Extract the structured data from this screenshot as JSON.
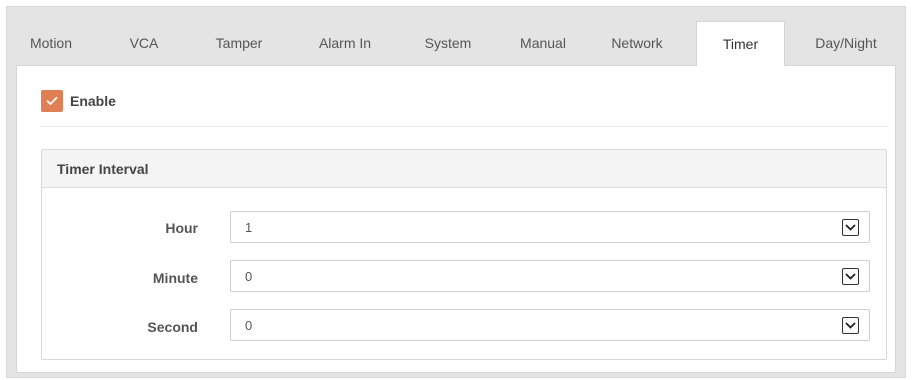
{
  "tabs": [
    {
      "label": "Motion",
      "active": false
    },
    {
      "label": "VCA",
      "active": false
    },
    {
      "label": "Tamper",
      "active": false
    },
    {
      "label": "Alarm In",
      "active": false
    },
    {
      "label": "System",
      "active": false
    },
    {
      "label": "Manual",
      "active": false
    },
    {
      "label": "Network",
      "active": false
    },
    {
      "label": "Timer",
      "active": true
    },
    {
      "label": "Day/Night",
      "active": false
    }
  ],
  "enable": {
    "label": "Enable",
    "checked": true
  },
  "timer_interval": {
    "title": "Timer Interval",
    "fields": [
      {
        "label": "Hour",
        "value": "1"
      },
      {
        "label": "Minute",
        "value": "0"
      },
      {
        "label": "Second",
        "value": "0"
      }
    ]
  },
  "colors": {
    "accent": "#e07f53",
    "tab_bar": "#e4e4e4"
  },
  "icons": {
    "checkbox": "checkmark-icon",
    "dropdown": "chevron-down-icon"
  }
}
